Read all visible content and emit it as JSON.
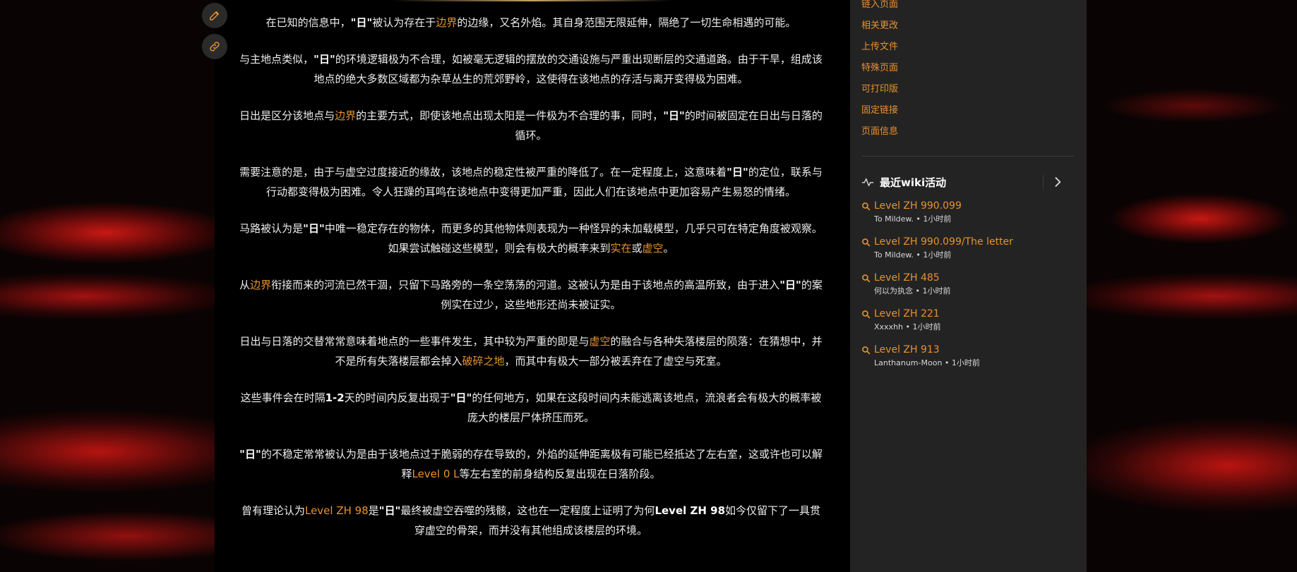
{
  "colors": {
    "accent": "#e8922e",
    "content_bg": "#000000",
    "sidebar_bg": "#232323"
  },
  "tools": {
    "edit_icon": "pencil-icon",
    "link_icon": "link-icon"
  },
  "article": {
    "p1": {
      "a": "在已知的信息中，",
      "b1": "\"日\"",
      "c": "被认为存在于",
      "l1": "边界",
      "d": "的边缘，又名外焰。其自身范围无限延伸，隔绝了一切生命相遇的可能。"
    },
    "p2": {
      "a": "与主地点类似，",
      "b1": "\"日\"",
      "c": "的环境逻辑极为不合理，如被毫无逻辑的摆放的交通设施与严重出现断层的交通道路。由于干旱，组成该地点的绝大多数区域都为杂草丛生的荒郊野岭，这使得在该地点的存活与离开变得极为困难。"
    },
    "p3": {
      "a": "日出是区分该地点与",
      "l1": "边界",
      "c": "的主要方式，即使该地点出现太阳是一件极为不合理的事，同时，",
      "b1": "\"日\"",
      "d": "的时间被固定在日出与日落的循环。"
    },
    "p4": {
      "a": "需要注意的是，由于与虚空过度接近的缘故，该地点的稳定性被严重的降低了。在一定程度上，这意味着",
      "b1": "\"日\"",
      "c": "的定位，联系与行动都变得极为困难。令人狂躁的耳鸣在该地点中变得更加严重，因此人们在该地点中更加容易产生易怒的情绪。"
    },
    "p5": {
      "a": "马路被认为是",
      "b1": "\"日\"",
      "c": "中唯一稳定存在的物体，而更多的其他物体则表现为一种怪异的未加载模型，几乎只可在特定角度被观察。如果尝试触碰这些模型，则会有极大的概率来到",
      "l1": "实在",
      "d": "或",
      "l2": "虚空",
      "e": "。"
    },
    "p6": {
      "a": "从",
      "l1": "边界",
      "c": "衔接而来的河流已然干涸，只留下马路旁的一条空荡荡的河道。这被认为是由于该地点的高温所致，由于进入",
      "b1": "\"日\"",
      "d": "的案例实在过少，这些地形还尚未被证实。"
    },
    "p7": {
      "a": "日出与日落的交替常常意味着地点的一些事件发生，其中较为严重的即是与",
      "l1": "虚空",
      "c": "的融合与各种失落楼层的陨落：在猜想中，并不是所有失落楼层都会掉入",
      "l2": "破碎之地",
      "d": "，而其中有极大一部分被丢弃在了虚空与死室。"
    },
    "p8": {
      "a": "这些事件会在时隔",
      "b1": "1-2",
      "c": "天的时间内反复出现于",
      "b2": "\"日\"",
      "d": "的任何地方，如果在这段时间内未能逃离该地点，流浪者会有极大的概率被庞大的楼层尸体挤压而死。"
    },
    "p9": {
      "b1": "\"日\"",
      "a": "的不稳定常常被认为是由于该地点过于脆弱的存在导致的，外焰的延伸距离极有可能已经抵达了左右室，这或许也可以解释",
      "l1": "Level 0 L",
      "c": "等左右室的前身结构反复出现在日落阶段。"
    },
    "p10": {
      "a": "曾有理论认为",
      "l1": "Level ZH 98",
      "c": "是",
      "b1": "\"日\"",
      "d": "最终被虚空吞噬的残骸，这也在一定程度上证明了为何",
      "b2": "Level ZH 98",
      "e": "如今仅留下了一具贯穿虚空的骨架，而并没有其他组成该楼层的环境。"
    }
  },
  "sidebar": {
    "tools": [
      "链入页面",
      "相关更改",
      "上传文件",
      "特殊页面",
      "可打印版",
      "固定链接",
      "页面信息"
    ],
    "activity_title": "最近wiki活动",
    "activity_icon": "activity-icon",
    "arrow_icon": "chevron-right-icon",
    "activity": [
      {
        "title": "Level ZH 990.099",
        "meta": "To Mildew. • 1小时前"
      },
      {
        "title": "Level ZH 990.099/The letter",
        "meta": "To Mildew. • 1小时前"
      },
      {
        "title": "Level ZH 485",
        "meta": "何以为执念 • 1小时前"
      },
      {
        "title": "Level ZH 221",
        "meta": "Xxxxhh • 1小时前"
      },
      {
        "title": "Level ZH 913",
        "meta": "Lanthanum-Moon • 1小时前"
      }
    ]
  }
}
